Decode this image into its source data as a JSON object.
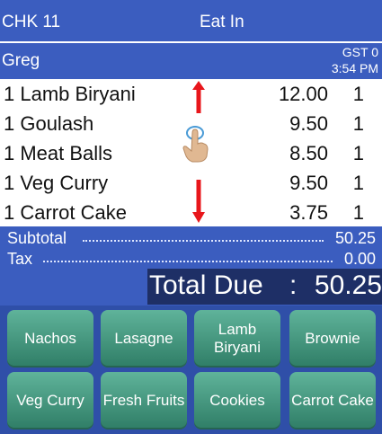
{
  "header": {
    "check": "CHK 11",
    "mode": "Eat In"
  },
  "customer": {
    "name": "Greg",
    "gst": "GST 0",
    "time": "3:54 PM"
  },
  "items": [
    {
      "name": "1 Lamb Biryani",
      "price": "12.00",
      "qty": "1"
    },
    {
      "name": "1 Goulash",
      "price": "9.50",
      "qty": "1"
    },
    {
      "name": "1 Meat Balls",
      "price": "8.50",
      "qty": "1"
    },
    {
      "name": "1 Veg Curry",
      "price": "9.50",
      "qty": "1"
    },
    {
      "name": "1 Carrot Cake",
      "price": "3.75",
      "qty": "1"
    }
  ],
  "totals": {
    "subtotal_label": "Subtotal",
    "subtotal": "50.25",
    "tax_label": "Tax",
    "tax": "0.00",
    "due_label": "Total Due",
    "due_sep": ":",
    "due": "50.25"
  },
  "menu_buttons": [
    "Nachos",
    "Lasagne",
    "Lamb Biryani",
    "Brownie",
    "Veg Curry",
    "Fresh Fruits",
    "Cookies",
    "Carrot Cake"
  ],
  "colors": {
    "header_bg": "#3b5dbf",
    "due_bg": "#1e2f66",
    "button": "#3f9a80",
    "arrow": "#e8161b"
  },
  "icons": {
    "scroll_up": "red-up-arrow-icon",
    "scroll_down": "red-down-arrow-icon",
    "touch": "hand-pointer-icon"
  }
}
